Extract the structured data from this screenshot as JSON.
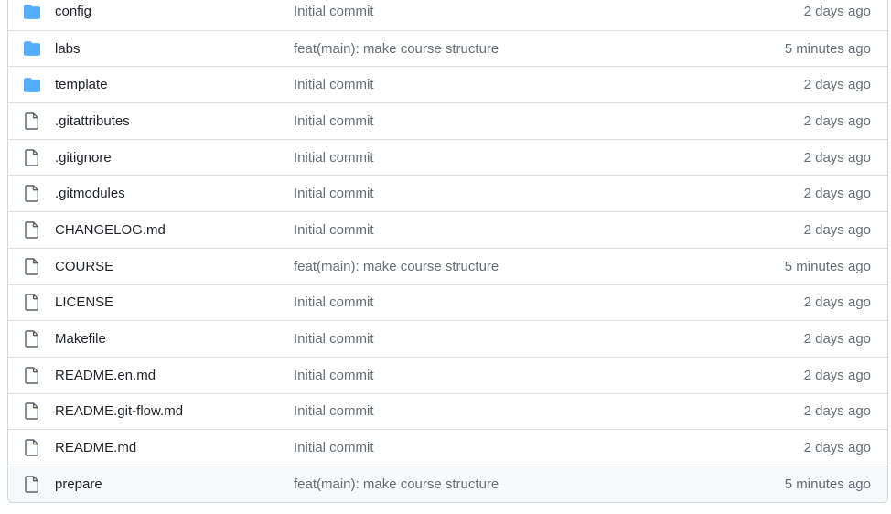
{
  "colors": {
    "folder_icon": "#54aeff",
    "file_icon": "#57606a",
    "row_border": "#d8dee4",
    "hover_row": "#f6f8fa",
    "muted_text": "#656d76"
  },
  "files": [
    {
      "icon": "folder-icon",
      "name": "config",
      "message": "Initial commit",
      "age": "2 days ago"
    },
    {
      "icon": "folder-icon",
      "name": "labs",
      "message": "feat(main): make course structure",
      "age": "5 minutes ago"
    },
    {
      "icon": "folder-icon",
      "name": "template",
      "message": "Initial commit",
      "age": "2 days ago"
    },
    {
      "icon": "file-icon",
      "name": ".gitattributes",
      "message": "Initial commit",
      "age": "2 days ago"
    },
    {
      "icon": "file-icon",
      "name": ".gitignore",
      "message": "Initial commit",
      "age": "2 days ago"
    },
    {
      "icon": "file-icon",
      "name": ".gitmodules",
      "message": "Initial commit",
      "age": "2 days ago"
    },
    {
      "icon": "file-icon",
      "name": "CHANGELOG.md",
      "message": "Initial commit",
      "age": "2 days ago"
    },
    {
      "icon": "file-icon",
      "name": "COURSE",
      "message": "feat(main): make course structure",
      "age": "5 minutes ago"
    },
    {
      "icon": "file-icon",
      "name": "LICENSE",
      "message": "Initial commit",
      "age": "2 days ago"
    },
    {
      "icon": "file-icon",
      "name": "Makefile",
      "message": "Initial commit",
      "age": "2 days ago"
    },
    {
      "icon": "file-icon",
      "name": "README.en.md",
      "message": "Initial commit",
      "age": "2 days ago"
    },
    {
      "icon": "file-icon",
      "name": "README.git-flow.md",
      "message": "Initial commit",
      "age": "2 days ago"
    },
    {
      "icon": "file-icon",
      "name": "README.md",
      "message": "Initial commit",
      "age": "2 days ago"
    },
    {
      "icon": "file-icon",
      "name": "prepare",
      "message": "feat(main): make course structure",
      "age": "5 minutes ago",
      "hovered": true
    }
  ]
}
